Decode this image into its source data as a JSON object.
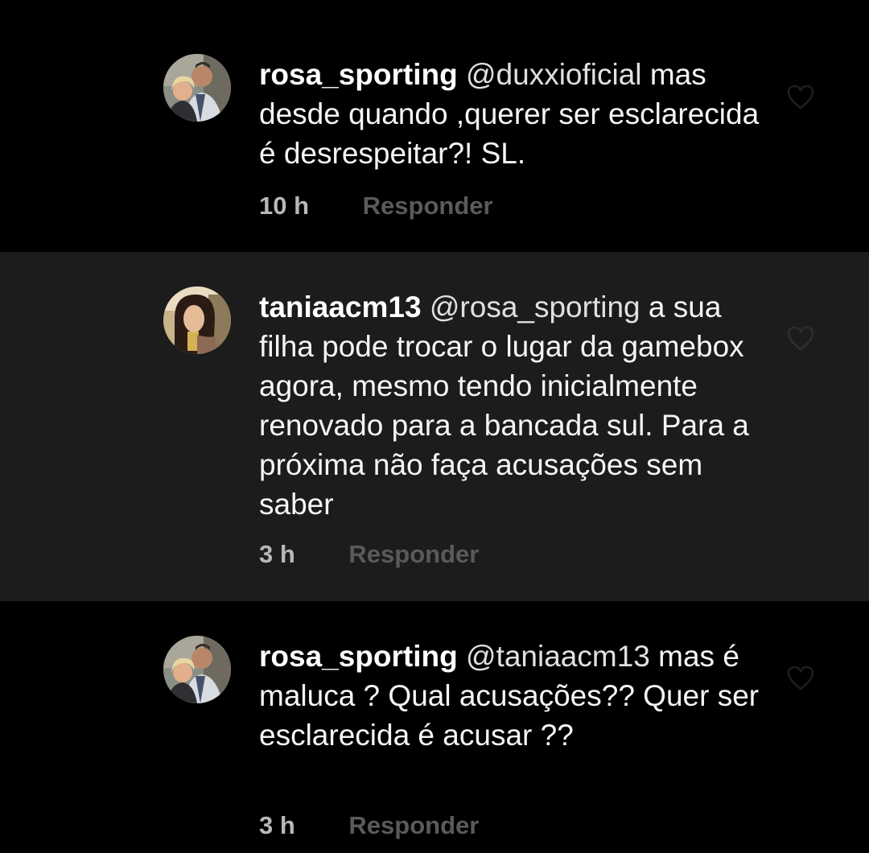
{
  "comments": [
    {
      "username": "rosa_sporting",
      "mention": "@duxxioficial",
      "text": "mas desde quando ,querer ser esclarecida é desrespeitar?! SL.",
      "time": "10 h",
      "reply_label": "Responder",
      "like_icon": "heart-outline-icon"
    },
    {
      "username": "taniaacm13",
      "mention": "@rosa_sporting",
      "text": "a sua filha pode trocar o lugar da gamebox agora, mesmo tendo inicialmente renovado para a bancada sul. Para a próxima não faça acusações sem saber",
      "time": "3 h",
      "reply_label": "Responder",
      "like_icon": "heart-outline-icon"
    },
    {
      "username": "rosa_sporting",
      "mention": "@taniaacm13",
      "text": "mas é maluca ? Qual acusações?? Quer ser esclarecida é acusar ??",
      "time": "3 h",
      "reply_label": "Responder",
      "like_icon": "heart-outline-icon"
    }
  ],
  "colors": {
    "background": "#000000",
    "highlighted_comment": "#1c1c1c",
    "text": "#f5f5f5",
    "time": "#b8b8b8",
    "reply": "#5a5a5a"
  }
}
